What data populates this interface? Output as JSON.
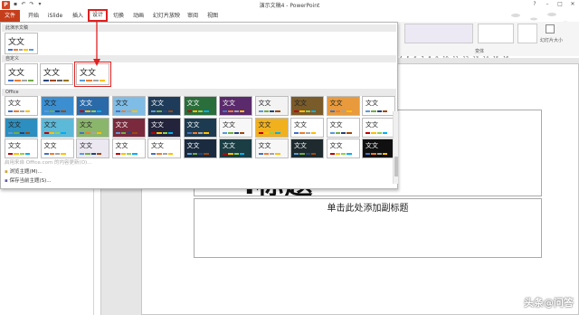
{
  "window": {
    "title": "演示文稿4 - PowerPoint",
    "min": "–",
    "max": "□",
    "close": "✕",
    "help": "?"
  },
  "tabs": [
    {
      "label": "文件"
    },
    {
      "label": "开始"
    },
    {
      "label": "iSlide"
    },
    {
      "label": "插入"
    },
    {
      "label": "设计"
    },
    {
      "label": "切换"
    },
    {
      "label": "动画"
    },
    {
      "label": "幻灯片放映"
    },
    {
      "label": "审阅"
    },
    {
      "label": "视图"
    }
  ],
  "ribbon": {
    "variant_label": "变体",
    "size_label": "幻灯片大小"
  },
  "gallery": {
    "section_current": "此演示文稿",
    "section_custom": "自定义",
    "section_office": "Office",
    "thumb_text": "文文",
    "office_themes_rows": [
      [
        "#ffffff",
        "#3b8fd1",
        "#2b6aa8",
        "#7fbde6",
        "#1e3c5a",
        "#2a6e3b",
        "#5b2a6c",
        "#f3f3f3",
        "#7a5b2a",
        "#e89a3c",
        "#ffffff"
      ],
      [
        "#2c8fbf",
        "#5cb9d8",
        "#8ab66b",
        "#7a2a3c",
        "#23243b",
        "#1c3b50",
        "#f7f7f7",
        "#f1b11f",
        "#ffffff",
        "#ffffff",
        "#ffffff"
      ],
      [
        "#ffffff",
        "#ffffff",
        "#ece8f2",
        "#ffffff",
        "#ffffff",
        "#1b2b3f",
        "#1b3d44",
        "#f7f7f7",
        "#1e2a2e",
        "#ffffff",
        "#101010"
      ]
    ],
    "menu": {
      "online": "启用来自 Office.com 的内容更新(O)...",
      "browse": "浏览主题(M)...",
      "save": "保存当前主题(S)..."
    }
  },
  "slide": {
    "title": "单击此处添加标题",
    "title_visible": "I标题",
    "subtitle": "单击此处添加副标题"
  },
  "watermark": "头条@问答",
  "colors": {
    "file_tab": "#c43e1c",
    "highlight": "#e02020"
  }
}
